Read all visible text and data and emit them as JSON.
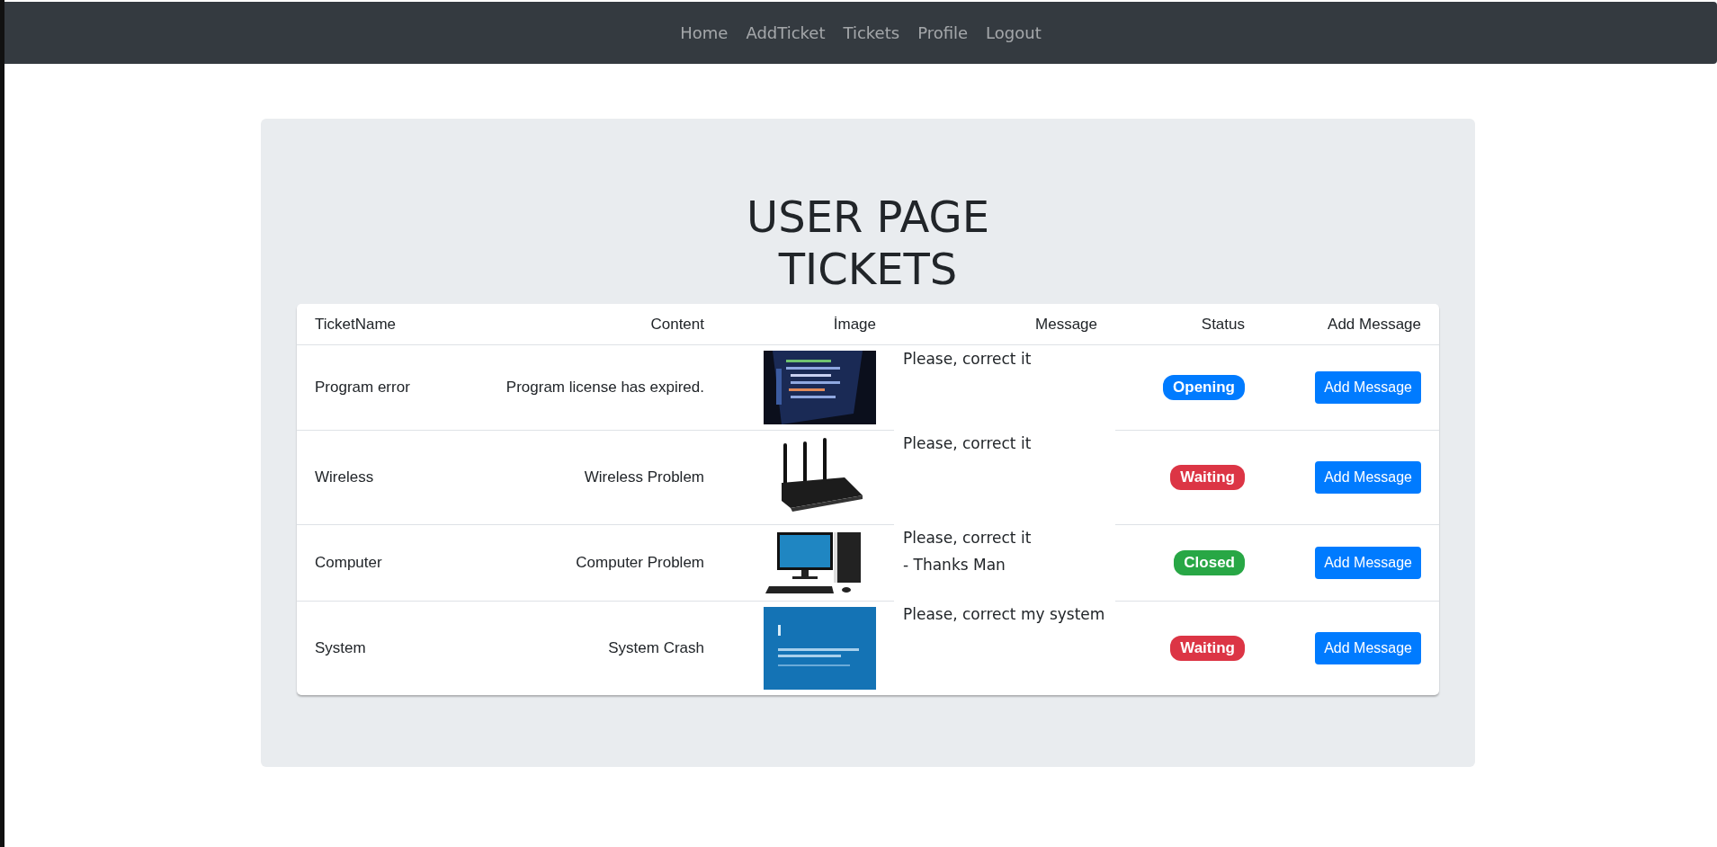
{
  "nav": {
    "links": [
      "Home",
      "AddTicket",
      "Tickets",
      "Profile",
      "Logout"
    ]
  },
  "heading": {
    "lines": [
      "USER PAGE",
      "TICKETS"
    ]
  },
  "table": {
    "columns": [
      "TicketName",
      "Content",
      "İmage",
      "Message",
      "Status",
      "Add Message"
    ],
    "rows": [
      {
        "name": "Program error",
        "content": "Program license has expired.",
        "image": {
          "kind": "picture"
        },
        "message": [
          "Please, correct it"
        ],
        "status": {
          "label": "Opening",
          "color": "#007bff"
        },
        "action": "Add Message"
      },
      {
        "name": "Wireless",
        "content": "Wireless Problem",
        "image": {
          "kind": "picture"
        },
        "message": [
          "Please, correct it"
        ],
        "status": {
          "label": "Waiting",
          "color": "#dc3545"
        },
        "action": "Add Message"
      },
      {
        "name": "Computer",
        "content": "Computer Problem",
        "image": {
          "kind": "picture"
        },
        "message": [
          "Please, correct it",
          "- Thanks Man"
        ],
        "status": {
          "label": "Closed",
          "color": "#28a745"
        },
        "action": "Add Message"
      },
      {
        "name": "System",
        "content": "System Crash",
        "image": {
          "kind": "picture"
        },
        "message": [
          "Please, correct my system"
        ],
        "status": {
          "label": "Waiting",
          "color": "#dc3545"
        },
        "action": "Add Message"
      }
    ]
  }
}
